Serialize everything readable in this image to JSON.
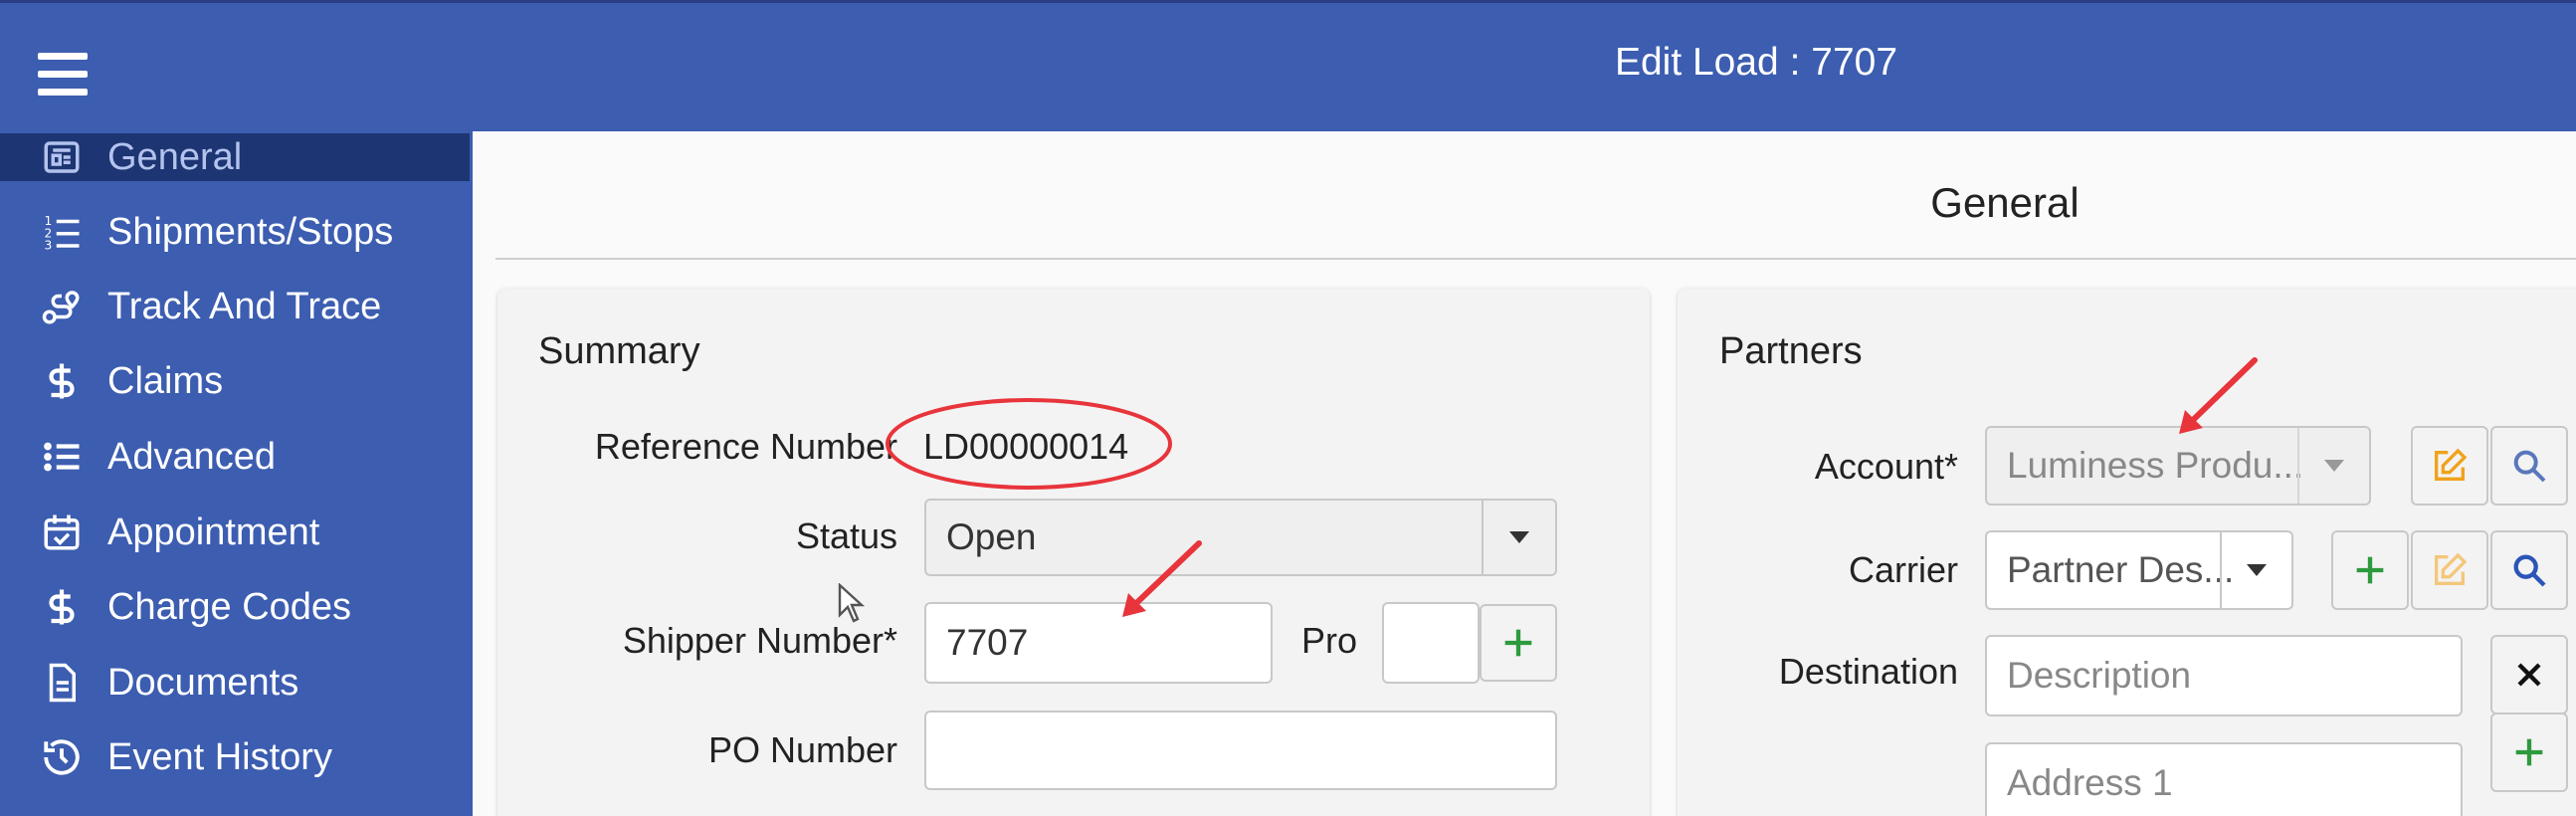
{
  "header": {
    "title": "Edit Load : 7707"
  },
  "sidebar": {
    "items": [
      {
        "label": "General",
        "icon": "newspaper-icon",
        "active": true
      },
      {
        "label": "Shipments/Stops",
        "icon": "numbered-list-icon"
      },
      {
        "label": "Track And Trace",
        "icon": "route-icon"
      },
      {
        "label": "Claims",
        "icon": "dollar-icon"
      },
      {
        "label": "Advanced",
        "icon": "list-icon"
      },
      {
        "label": "Appointment",
        "icon": "calendar-check-icon"
      },
      {
        "label": "Charge Codes",
        "icon": "dollar-icon"
      },
      {
        "label": "Documents",
        "icon": "document-icon"
      },
      {
        "label": "Event History",
        "icon": "history-icon"
      }
    ]
  },
  "main": {
    "heading": "General"
  },
  "summary": {
    "title": "Summary",
    "reference_label": "Reference Number",
    "reference_value": "LD00000014",
    "status_label": "Status",
    "status_value": "Open",
    "shipper_label": "Shipper Number*",
    "shipper_value": "7707",
    "pro_label": "Pro",
    "pro_value": "",
    "po_label": "PO Number",
    "po_value": ""
  },
  "partners": {
    "title": "Partners",
    "account_label": "Account*",
    "account_value": "Luminess Produ...",
    "carrier_label": "Carrier",
    "carrier_value": "Partner Des...",
    "destination_label": "Destination",
    "destination_placeholder": "Description",
    "address1_placeholder": "Address 1"
  },
  "colors": {
    "brand_blue": "#3c5db0",
    "active_nav": "#1d3572",
    "add_green": "#2e9a3e",
    "edit_orange": "#f0a21b",
    "search_blue": "#2c55b8",
    "annotation_red": "#e8343b"
  }
}
